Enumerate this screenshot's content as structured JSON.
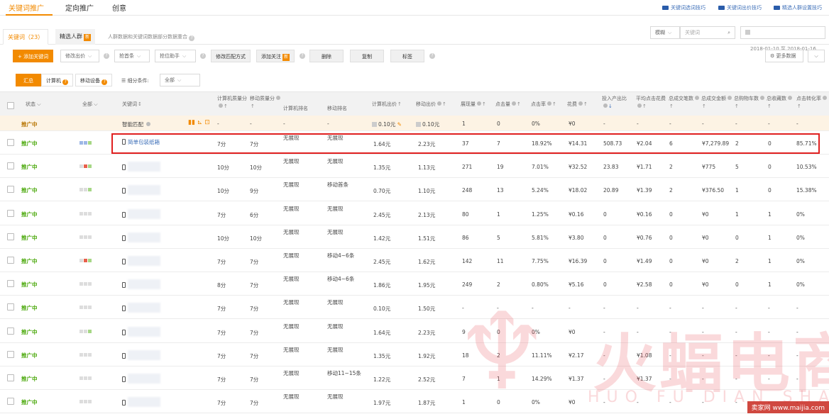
{
  "nav": {
    "tabs": [
      "关键词推广",
      "定向推广",
      "创意"
    ],
    "help_links": [
      "关键词选词技巧",
      "关键词出价技巧",
      "精选人群设置技巧"
    ]
  },
  "subtabs": {
    "keyword": "关键词（23）",
    "crowd": "精选人群",
    "new_badge": "新",
    "note": "人群数据和关键词数据部分数据重合"
  },
  "search": {
    "scope": "模糊",
    "placeholder": "关键词",
    "date_range": "2018-01-10 至 2018-01-16"
  },
  "toolbar": {
    "add_keyword": "添加关键词",
    "modify_bid": "修改出价",
    "grab_first": "抢首条",
    "position_helper": "抢位助手",
    "modify_match": "修改匹配方式",
    "add_follow": "添加关注",
    "delete": "删除",
    "copy": "复制",
    "tag": "标签",
    "more_data": "更多数据"
  },
  "filters": {
    "summary": "汇总",
    "computer": "计算机",
    "mobile": "移动设备",
    "segment_label": "细分条件:",
    "segment_value": "全部"
  },
  "columns": [
    "状态",
    "全部",
    "关键词",
    "计算机质量分",
    "移动质量分",
    "计算机排名",
    "移动排名",
    "计算机出价",
    "移动出价",
    "展现量",
    "点击量",
    "点击率",
    "花费",
    "投入产出比",
    "平均点击花费",
    "总成交笔数",
    "总成交金额",
    "总购物车数",
    "总收藏数",
    "点击转化率"
  ],
  "smart_row": {
    "status": "推广中",
    "keyword": "智能匹配",
    "pc_q": "-",
    "m_q": "-",
    "pc_rank": "-",
    "m_rank": "-",
    "pc_bid": "0.10元",
    "m_bid": "0.10元",
    "impr": "1",
    "clicks": "0",
    "ctr": "0%",
    "cost": "¥0",
    "roi": "-",
    "cpc": "-",
    "orders": "-",
    "gmv": "-",
    "cart": "-",
    "fav": "-",
    "cvr": "-"
  },
  "rows": [
    {
      "status": "推广中",
      "keyword": "简单包装纸箱",
      "pc_q": "7分",
      "m_q": "7分",
      "pc_rank": "无展现",
      "m_rank": "无展现",
      "pc_bid": "1.64元",
      "m_bid": "2.23元",
      "impr": "37",
      "clicks": "7",
      "ctr": "18.92%",
      "cost": "¥14.31",
      "roi": "508.73",
      "cpc": "¥2.04",
      "orders": "6",
      "gmv": "¥7,279.89",
      "cart": "2",
      "fav": "0",
      "cvr": "85.71%"
    },
    {
      "status": "推广中",
      "keyword": "",
      "pc_q": "10分",
      "m_q": "10分",
      "pc_rank": "无展现",
      "m_rank": "无展现",
      "pc_bid": "1.35元",
      "m_bid": "1.13元",
      "impr": "271",
      "clicks": "19",
      "ctr": "7.01%",
      "cost": "¥32.52",
      "roi": "23.83",
      "cpc": "¥1.71",
      "orders": "2",
      "gmv": "¥775",
      "cart": "5",
      "fav": "0",
      "cvr": "10.53%"
    },
    {
      "status": "推广中",
      "keyword": "",
      "pc_q": "10分",
      "m_q": "9分",
      "pc_rank": "无展现",
      "m_rank": "移动首条",
      "pc_bid": "0.70元",
      "m_bid": "1.10元",
      "impr": "248",
      "clicks": "13",
      "ctr": "5.24%",
      "cost": "¥18.02",
      "roi": "20.89",
      "cpc": "¥1.39",
      "orders": "2",
      "gmv": "¥376.50",
      "cart": "1",
      "fav": "0",
      "cvr": "15.38%"
    },
    {
      "status": "推广中",
      "keyword": "",
      "pc_q": "7分",
      "m_q": "6分",
      "pc_rank": "无展现",
      "m_rank": "无展现",
      "pc_bid": "2.45元",
      "m_bid": "2.13元",
      "impr": "80",
      "clicks": "1",
      "ctr": "1.25%",
      "cost": "¥0.16",
      "roi": "0",
      "cpc": "¥0.16",
      "orders": "0",
      "gmv": "¥0",
      "cart": "1",
      "fav": "1",
      "cvr": "0%"
    },
    {
      "status": "推广中",
      "keyword": "",
      "pc_q": "10分",
      "m_q": "10分",
      "pc_rank": "无展现",
      "m_rank": "无展现",
      "pc_bid": "1.42元",
      "m_bid": "1.51元",
      "impr": "86",
      "clicks": "5",
      "ctr": "5.81%",
      "cost": "¥3.80",
      "roi": "0",
      "cpc": "¥0.76",
      "orders": "0",
      "gmv": "¥0",
      "cart": "0",
      "fav": "1",
      "cvr": "0%"
    },
    {
      "status": "推广中",
      "keyword": "",
      "pc_q": "7分",
      "m_q": "7分",
      "pc_rank": "无展现",
      "m_rank": "移动4~6条",
      "pc_bid": "2.45元",
      "m_bid": "1.62元",
      "impr": "142",
      "clicks": "11",
      "ctr": "7.75%",
      "cost": "¥16.39",
      "roi": "0",
      "cpc": "¥1.49",
      "orders": "0",
      "gmv": "¥0",
      "cart": "2",
      "fav": "1",
      "cvr": "0%"
    },
    {
      "status": "推广中",
      "keyword": "",
      "pc_q": "8分",
      "m_q": "7分",
      "pc_rank": "无展现",
      "m_rank": "移动4~6条",
      "pc_bid": "1.86元",
      "m_bid": "1.95元",
      "impr": "249",
      "clicks": "2",
      "ctr": "0.80%",
      "cost": "¥5.16",
      "roi": "0",
      "cpc": "¥2.58",
      "orders": "0",
      "gmv": "¥0",
      "cart": "0",
      "fav": "1",
      "cvr": "0%"
    },
    {
      "status": "推广中",
      "keyword": "",
      "pc_q": "7分",
      "m_q": "7分",
      "pc_rank": "无展现",
      "m_rank": "无展现",
      "pc_bid": "0.10元",
      "m_bid": "1.50元",
      "impr": "-",
      "clicks": "-",
      "ctr": "-",
      "cost": "-",
      "roi": "-",
      "cpc": "-",
      "orders": "-",
      "gmv": "-",
      "cart": "-",
      "fav": "-",
      "cvr": "-"
    },
    {
      "status": "推广中",
      "keyword": "",
      "pc_q": "7分",
      "m_q": "7分",
      "pc_rank": "无展现",
      "m_rank": "无展现",
      "pc_bid": "1.64元",
      "m_bid": "2.23元",
      "impr": "9",
      "clicks": "0",
      "ctr": "0%",
      "cost": "¥0",
      "roi": "-",
      "cpc": "-",
      "orders": "-",
      "gmv": "-",
      "cart": "-",
      "fav": "-",
      "cvr": "-"
    },
    {
      "status": "推广中",
      "keyword": "",
      "pc_q": "7分",
      "m_q": "7分",
      "pc_rank": "无展现",
      "m_rank": "无展现",
      "pc_bid": "1.35元",
      "m_bid": "1.92元",
      "impr": "18",
      "clicks": "2",
      "ctr": "11.11%",
      "cost": "¥2.17",
      "roi": "-",
      "cpc": "¥1.08",
      "orders": "-",
      "gmv": "-",
      "cart": "-",
      "fav": "-",
      "cvr": "-"
    },
    {
      "status": "推广中",
      "keyword": "",
      "pc_q": "7分",
      "m_q": "7分",
      "pc_rank": "无展现",
      "m_rank": "移动11~15条",
      "pc_bid": "1.22元",
      "m_bid": "2.52元",
      "impr": "7",
      "clicks": "1",
      "ctr": "14.29%",
      "cost": "¥1.37",
      "roi": "-",
      "cpc": "¥1.37",
      "orders": "-",
      "gmv": "-",
      "cart": "-",
      "fav": "-",
      "cvr": "-"
    },
    {
      "status": "推广中",
      "keyword": "",
      "pc_q": "7分",
      "m_q": "7分",
      "pc_rank": "无展现",
      "m_rank": "无展现",
      "pc_bid": "1.97元",
      "m_bid": "1.87元",
      "impr": "1",
      "clicks": "0",
      "ctr": "0%",
      "cost": "¥0",
      "roi": "-",
      "cpc": "-",
      "orders": "-",
      "gmv": "-",
      "cart": "-",
      "fav": "-",
      "cvr": "-"
    }
  ],
  "watermark": {
    "brand_cn": "火蝠电商",
    "brand_en": "HUO FU DIAN SHANG",
    "corner": "卖家网 www.maijia.com"
  },
  "colors": {
    "accent": "#f28a00",
    "status_green": "#4aa80a",
    "highlight": "#e02020",
    "link": "#3d6fb8"
  }
}
